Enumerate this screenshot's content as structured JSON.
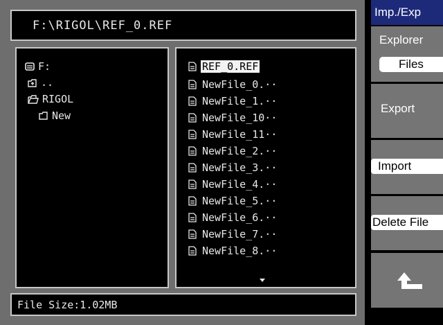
{
  "path": "F:\\RIGOL\\REF_0.REF",
  "status": "File Size:1.02MB",
  "tree": [
    {
      "label": "F:",
      "icon": "drive-icon"
    },
    {
      "label": "..",
      "icon": "parent-folder-icon"
    },
    {
      "label": "RIGOL",
      "icon": "open-folder-icon"
    },
    {
      "label": "New",
      "icon": "folder-icon"
    }
  ],
  "files": [
    "REF_0.REF",
    "NewFile_0.··",
    "NewFile_1.··",
    "NewFile_10··",
    "NewFile_11··",
    "NewFile_2.··",
    "NewFile_3.··",
    "NewFile_4.··",
    "NewFile_5.··",
    "NewFile_6.··",
    "NewFile_7.··",
    "NewFile_8.··"
  ],
  "selected_file": "REF_0.REF",
  "menu": {
    "title": "Imp./Exp",
    "explorer_label": "Explorer",
    "explorer_value": "Files",
    "export_label": "Export",
    "import_label": "Import",
    "delete_label": "Delete File",
    "back_icon": "return-arrow-icon"
  },
  "colors": {
    "menu_title_bg": "#1d2a7a",
    "softkey_bg": "#757575",
    "screen_bg": "#6e6e6e"
  }
}
